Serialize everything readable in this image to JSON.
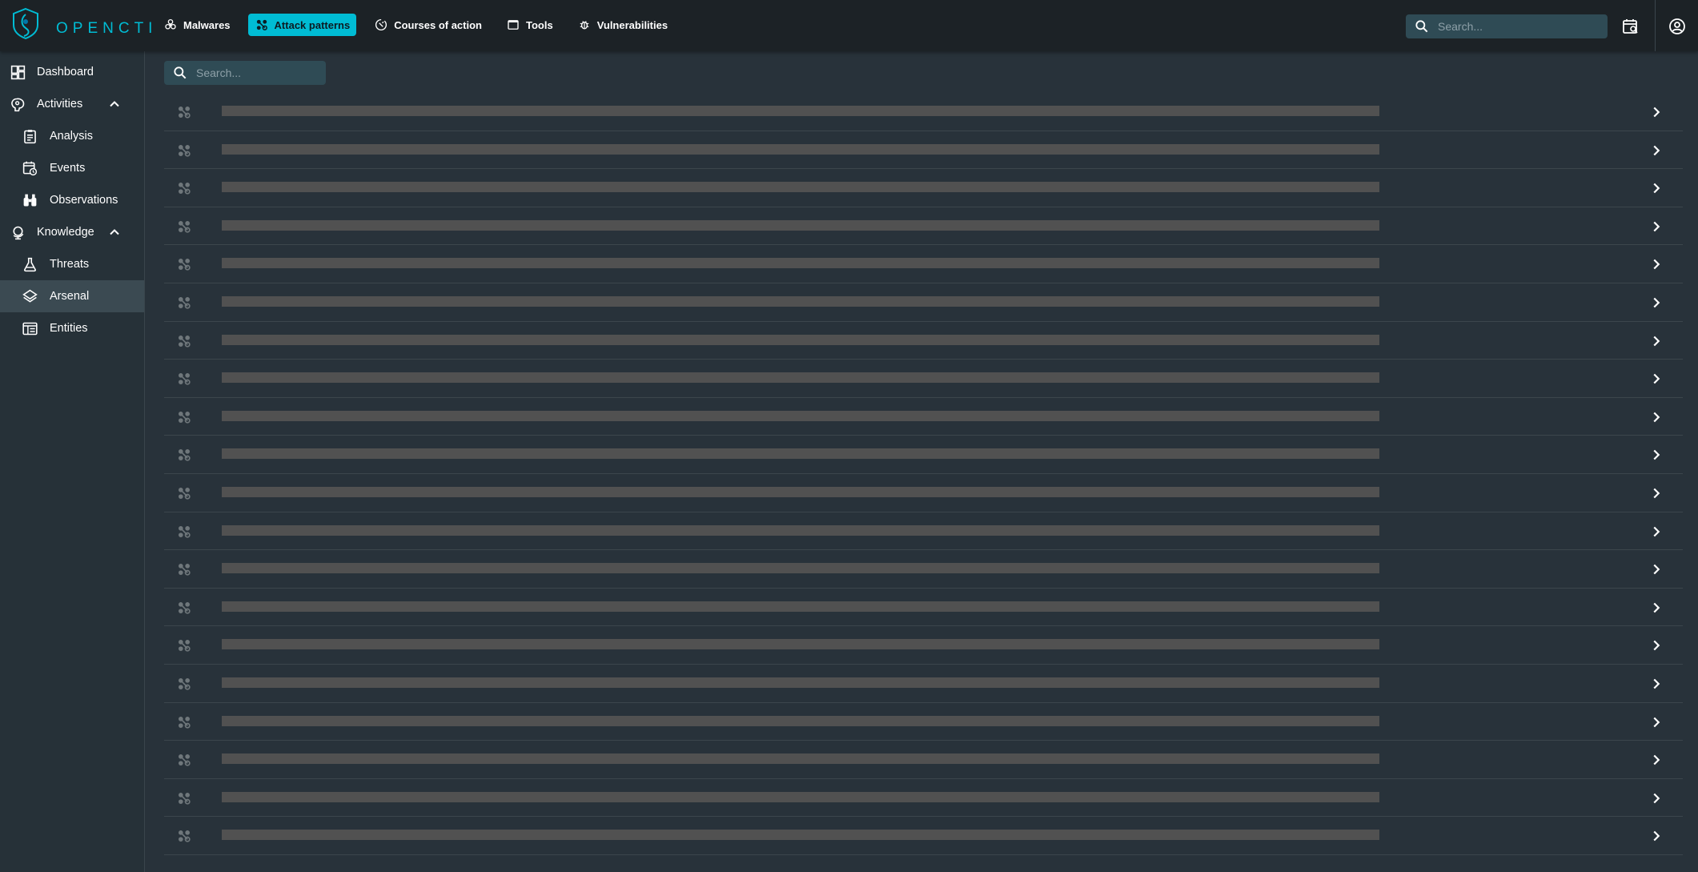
{
  "app": {
    "logo_text": "OPENCTI"
  },
  "colors": {
    "accent": "#00bcd4",
    "background": "#28323a",
    "topbar": "#1c2226",
    "sidebar": "#263138",
    "skeleton": "#515151"
  },
  "topnav": {
    "items": [
      {
        "label": "Malwares",
        "icon": "biohazard-icon",
        "active": false
      },
      {
        "label": "Attack patterns",
        "icon": "attack-pattern-icon",
        "active": true
      },
      {
        "label": "Courses of action",
        "icon": "progress-wrench-icon",
        "active": false
      },
      {
        "label": "Tools",
        "icon": "window-icon",
        "active": false
      },
      {
        "label": "Vulnerabilities",
        "icon": "bug-icon",
        "active": false
      }
    ],
    "search_placeholder": "Search..."
  },
  "sidebar": {
    "items": [
      {
        "label": "Dashboard",
        "icon": "dashboard-icon"
      },
      {
        "label": "Activities",
        "icon": "brain-icon",
        "expanded": true
      },
      {
        "label": "Analysis",
        "icon": "clipboard-icon"
      },
      {
        "label": "Events",
        "icon": "calendar-clock-icon"
      },
      {
        "label": "Observations",
        "icon": "binoculars-icon"
      },
      {
        "label": "Knowledge",
        "icon": "globe-icon",
        "expanded": true
      },
      {
        "label": "Threats",
        "icon": "flask-icon"
      },
      {
        "label": "Arsenal",
        "icon": "layers-icon",
        "selected": true
      },
      {
        "label": "Entities",
        "icon": "card-table-icon"
      }
    ]
  },
  "main": {
    "search_placeholder": "Search...",
    "row_count": 20
  }
}
